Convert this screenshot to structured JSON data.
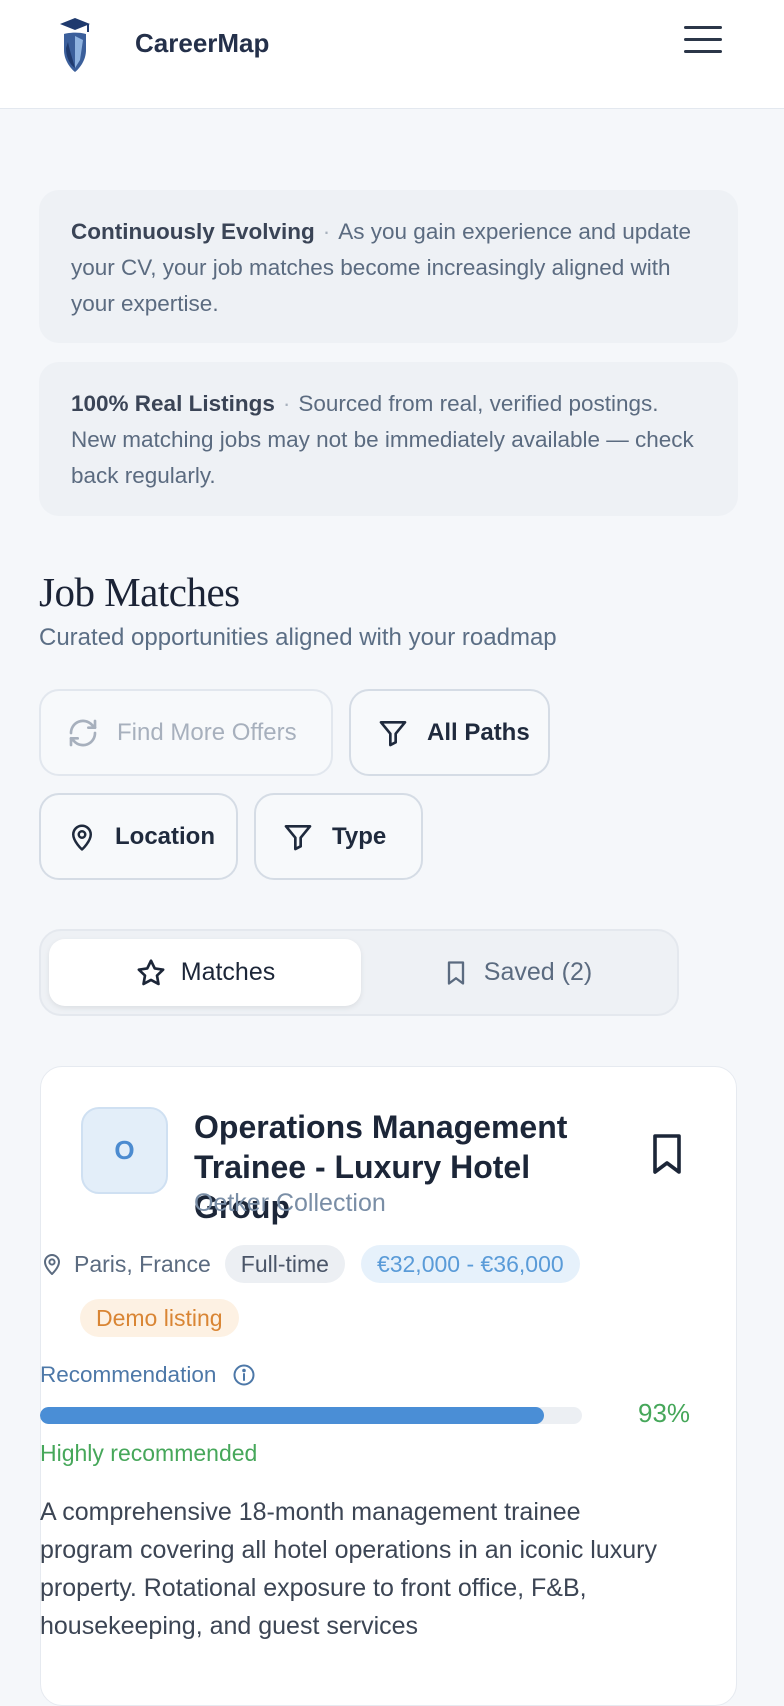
{
  "header": {
    "brand": "CareerMap"
  },
  "info_boxes": [
    {
      "title": "Continuously Evolving",
      "separator": "·",
      "text": "As you gain experience and update your CV, your job matches become increasingly aligned with your expertise."
    },
    {
      "title": "100% Real Listings",
      "separator": "·",
      "text": "Sourced from real, verified postings. New matching jobs may not be immediately available — check back regularly."
    }
  ],
  "section": {
    "title": "Job Matches",
    "subtitle": "Curated opportunities aligned with your roadmap"
  },
  "filters": {
    "find_more": "Find More Offers",
    "all_paths": "All Paths",
    "location": "Location",
    "type": "Type"
  },
  "tabs": [
    {
      "label": "Matches",
      "icon": "star-icon",
      "active": true
    },
    {
      "label": "Saved (2)",
      "icon": "bookmark-icon",
      "active": false
    }
  ],
  "job": {
    "logo_letter": "O",
    "title": "Operations Management Trainee - Luxury Hotel Group",
    "company": "Oetker Collection",
    "location": "Paris, France",
    "employment_type": "Full-time",
    "salary": "€32,000 - €36,000",
    "badge": "Demo listing",
    "recommendation_label": "Recommendation",
    "recommendation_percent": 93,
    "recommendation_display": "93%",
    "recommendation_text": "Highly recommended",
    "description": "A comprehensive 18-month management trainee program covering all hotel operations in an iconic luxury property. Rotational exposure to front office, F&B, housekeeping, and guest services"
  },
  "colors": {
    "accent_blue": "#4a8ed6",
    "success_green": "#46a75a",
    "demo_orange": "#d98534"
  }
}
